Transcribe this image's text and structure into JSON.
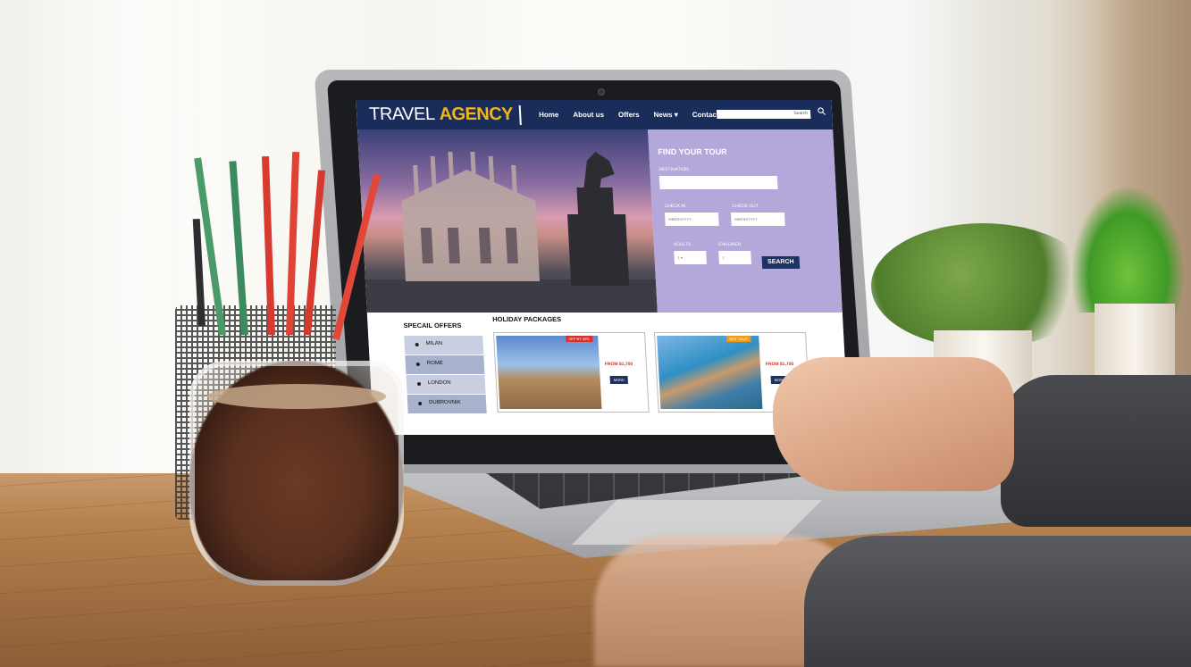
{
  "website": {
    "logo": {
      "part1": "TRAVEL",
      "part2": "AGENCY"
    },
    "nav": [
      "Home",
      "About us",
      "Offers",
      "News ▾",
      "Contact"
    ],
    "search_placeholder": "Search",
    "find_tour": {
      "title": "FIND YOUR TOUR",
      "destination_label": "DESTINATION",
      "checkin_label": "CHECK IN",
      "checkout_label": "CHECK OUT",
      "checkin_value": "MM/DD/YYYY",
      "checkout_value": "MM/DD/YYYY",
      "adults_label": "ADULTS",
      "children_label": "CHILDREN",
      "adults_value": "1 ▾",
      "children_value": "1",
      "search_button": "SEARCH"
    },
    "special_offers": {
      "title": "SPECAIL OFFERS",
      "items": [
        "MILAN",
        "ROME",
        "LONDON",
        "DUBROVNIK"
      ]
    },
    "holiday_packages": {
      "title": "HOLIDAY PACKAGES",
      "cards": [
        {
          "tag": "OFF BY 30%",
          "price": "FROM $1,700",
          "button": "MORE"
        },
        {
          "tag": "HOT TOUR",
          "price": "FROM $1,700",
          "button": "MORE"
        }
      ]
    }
  },
  "colors": {
    "nav": "#1a2d5a",
    "accent": "#f2b51b",
    "panel": "#b3a8d9",
    "button": "#1d3363"
  }
}
